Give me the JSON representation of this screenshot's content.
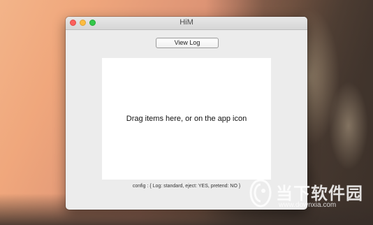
{
  "window": {
    "title": "HiM",
    "view_log_label": "View Log",
    "drop_text": "Drag items here, or on the app icon",
    "config_text": "config : { Log: standard, eject: YES, pretend: NO }"
  },
  "watermark": {
    "text": "当下软件园",
    "url": "www.downxia.com"
  },
  "colors": {
    "close": "#fc605c",
    "minimize": "#fdbc40",
    "maximize": "#34c84a"
  }
}
